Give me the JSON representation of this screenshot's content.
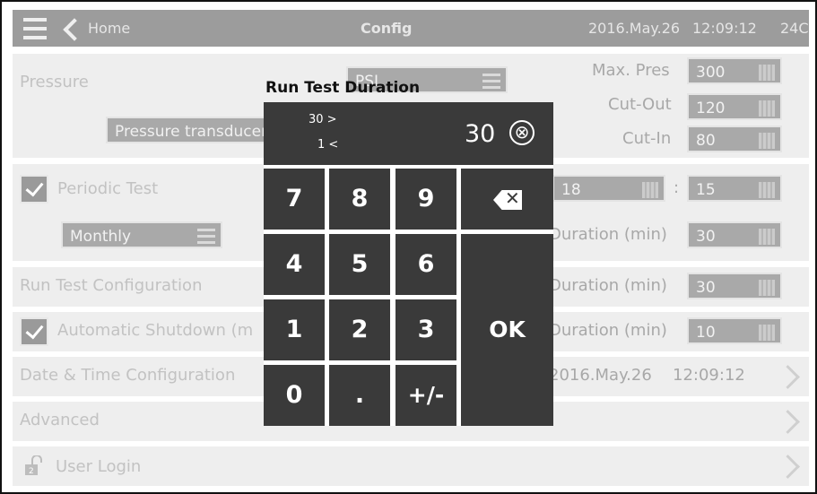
{
  "topbar": {
    "back_label": "Home",
    "title": "Config",
    "date": "2016.May.26",
    "time": "12:09:12",
    "temp": "24C"
  },
  "pressure": {
    "label": "Pressure",
    "unit": "PSI",
    "sensor": "Pressure transducer",
    "max_label": "Max. Pres",
    "max_value": "300",
    "cutout_label": "Cut-Out",
    "cutout_value": "120",
    "cutin_label": "Cut-In",
    "cutin_value": "80"
  },
  "periodic": {
    "label": "Periodic Test",
    "frequency": "Monthly",
    "hour": "18",
    "minute": "15",
    "duration_label": "Duration (min)",
    "duration_value": "30"
  },
  "run_test": {
    "label": "Run Test Configuration",
    "duration_label": "Duration (min)",
    "duration_value": "30"
  },
  "auto_shutdown": {
    "label": "Automatic Shutdown (m",
    "duration_label": "Duration (min)",
    "duration_value": "10"
  },
  "datetime": {
    "label": "Date & Time Configuration",
    "date": "2016.May.26",
    "time": "12:09:12"
  },
  "advanced": {
    "label": "Advanced"
  },
  "login": {
    "label": "User Login",
    "lock_level": "2"
  },
  "keypad": {
    "title": "Run Test Duration",
    "max_text": "30 >",
    "min_text": "1 <",
    "value": "30",
    "keys": [
      "7",
      "8",
      "9",
      "4",
      "5",
      "6",
      "1",
      "2",
      "3",
      "0",
      ".",
      "+/-"
    ],
    "ok_label": "OK",
    "clear_glyph": "⊗"
  },
  "colors": {
    "topbar": "#9c9c9c",
    "keypad": "#3a3a3a",
    "row_bg": "#eeeeee"
  }
}
